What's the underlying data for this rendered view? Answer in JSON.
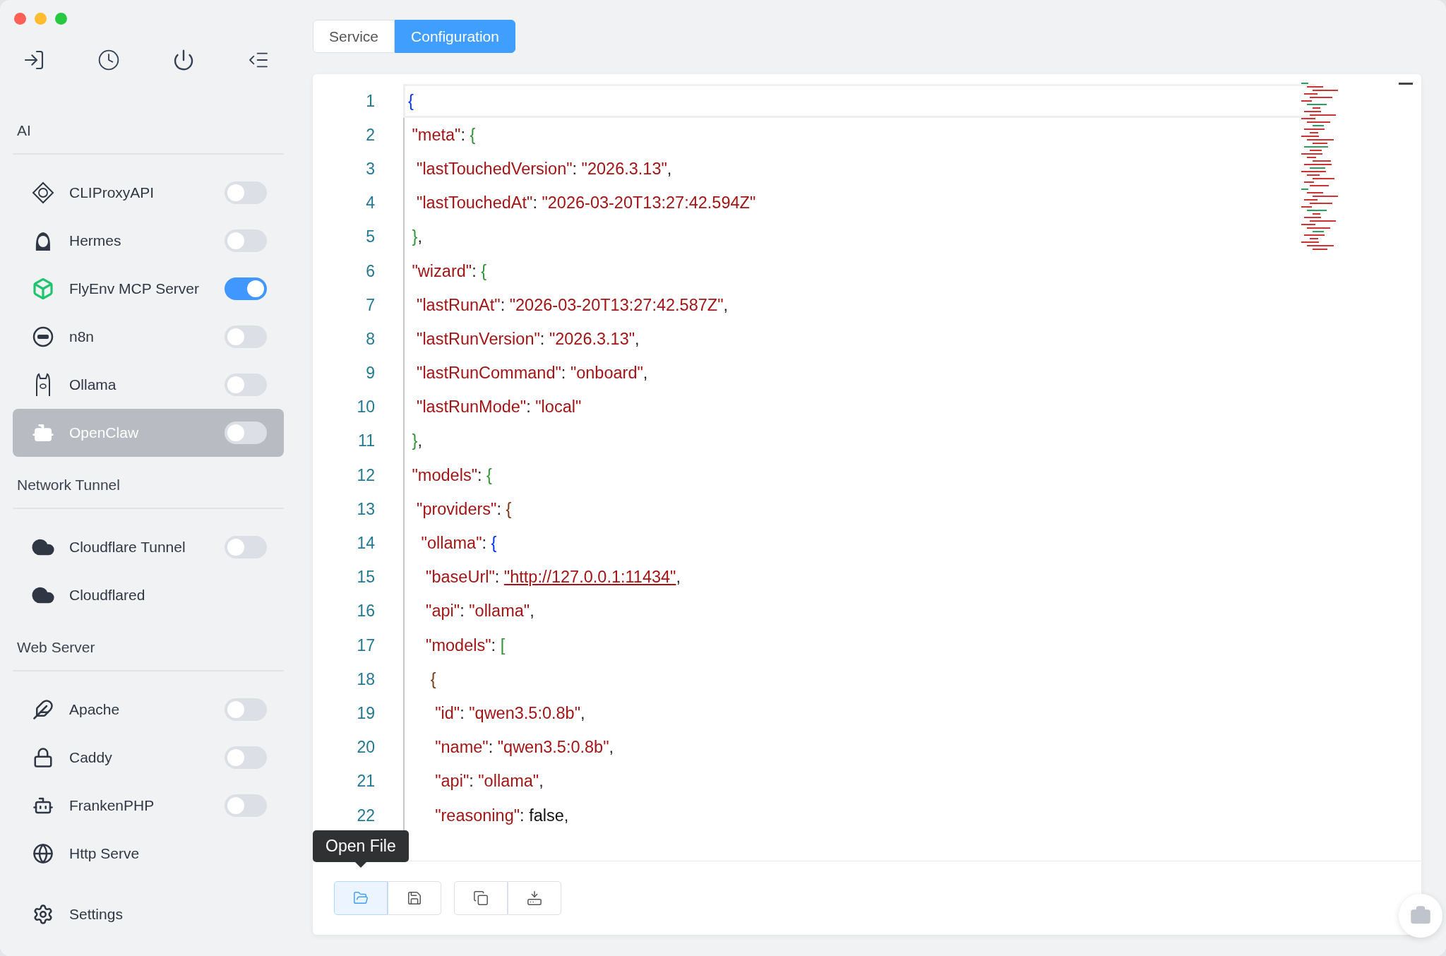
{
  "tabs": [
    {
      "label": "Service",
      "selected": false
    },
    {
      "label": "Configuration",
      "selected": true
    }
  ],
  "sidebar": {
    "groups": [
      {
        "title": "AI",
        "items": [
          {
            "label": "CLIProxyAPI",
            "on": false,
            "selected": false
          },
          {
            "label": "Hermes",
            "on": false,
            "selected": false
          },
          {
            "label": "FlyEnv MCP Server",
            "on": true,
            "selected": false
          },
          {
            "label": "n8n",
            "on": false,
            "selected": false
          },
          {
            "label": "Ollama",
            "on": false,
            "selected": false
          },
          {
            "label": "OpenClaw",
            "on": false,
            "selected": true
          }
        ]
      },
      {
        "title": "Network Tunnel",
        "items": [
          {
            "label": "Cloudflare Tunnel",
            "on": false,
            "selected": false
          },
          {
            "label": "Cloudflared",
            "selected": false
          }
        ]
      },
      {
        "title": "Web Server",
        "items": [
          {
            "label": "Apache",
            "on": false,
            "selected": false
          },
          {
            "label": "Caddy",
            "on": false,
            "selected": false
          },
          {
            "label": "FrankenPHP",
            "on": false,
            "selected": false
          },
          {
            "label": "Http Serve",
            "selected": false
          }
        ]
      }
    ],
    "settings": "Settings"
  },
  "editor": {
    "lines": [
      {
        "number": "1",
        "tokens": [
          {
            "kind": "bracket",
            "text": "{"
          }
        ]
      },
      {
        "number": "2",
        "tokens": [
          {
            "kind": "key",
            "text": " \"meta\""
          },
          {
            "kind": "punct",
            "text": ": "
          },
          {
            "kind": "bracket",
            "text": "{"
          }
        ]
      },
      {
        "number": "3",
        "tokens": [
          {
            "kind": "key",
            "text": "  \"lastTouchedVersion\""
          },
          {
            "kind": "punct",
            "text": ": "
          },
          {
            "kind": "string",
            "text": "\"2026.3.13\""
          },
          {
            "kind": "punct",
            "text": ","
          }
        ]
      },
      {
        "number": "4",
        "tokens": [
          {
            "kind": "key",
            "text": "  \"lastTouchedAt\""
          },
          {
            "kind": "punct",
            "text": ": "
          },
          {
            "kind": "string",
            "text": "\"2026-03-20T13:27:42.594Z\""
          }
        ]
      },
      {
        "number": "5",
        "tokens": [
          {
            "kind": "bracket",
            "text": " }"
          },
          {
            "kind": "punct",
            "text": ","
          }
        ]
      },
      {
        "number": "6",
        "tokens": [
          {
            "kind": "key",
            "text": " \"wizard\""
          },
          {
            "kind": "punct",
            "text": ": "
          },
          {
            "kind": "bracket",
            "text": "{"
          }
        ]
      },
      {
        "number": "7",
        "tokens": [
          {
            "kind": "key",
            "text": "  \"lastRunAt\""
          },
          {
            "kind": "punct",
            "text": ": "
          },
          {
            "kind": "string",
            "text": "\"2026-03-20T13:27:42.587Z\""
          },
          {
            "kind": "punct",
            "text": ","
          }
        ]
      },
      {
        "number": "8",
        "tokens": [
          {
            "kind": "key",
            "text": "  \"lastRunVersion\""
          },
          {
            "kind": "punct",
            "text": ": "
          },
          {
            "kind": "string",
            "text": "\"2026.3.13\""
          },
          {
            "kind": "punct",
            "text": ","
          }
        ]
      },
      {
        "number": "9",
        "tokens": [
          {
            "kind": "key",
            "text": "  \"lastRunCommand\""
          },
          {
            "kind": "punct",
            "text": ": "
          },
          {
            "kind": "string",
            "text": "\"onboard\""
          },
          {
            "kind": "punct",
            "text": ","
          }
        ]
      },
      {
        "number": "10",
        "tokens": [
          {
            "kind": "key",
            "text": "  \"lastRunMode\""
          },
          {
            "kind": "punct",
            "text": ": "
          },
          {
            "kind": "string",
            "text": "\"local\""
          }
        ]
      },
      {
        "number": "11",
        "tokens": [
          {
            "kind": "bracket",
            "text": " }"
          },
          {
            "kind": "punct",
            "text": ","
          }
        ]
      },
      {
        "number": "12",
        "tokens": [
          {
            "kind": "key",
            "text": " \"models\""
          },
          {
            "kind": "punct",
            "text": ": "
          },
          {
            "kind": "bracket",
            "text": "{"
          }
        ]
      },
      {
        "number": "13",
        "tokens": [
          {
            "kind": "key",
            "text": "  \"providers\""
          },
          {
            "kind": "punct",
            "text": ": "
          },
          {
            "kind": "bracket",
            "text": "{"
          }
        ]
      },
      {
        "number": "14",
        "tokens": [
          {
            "kind": "key",
            "text": "   \"ollama\""
          },
          {
            "kind": "punct",
            "text": ": "
          },
          {
            "kind": "bracket",
            "text": "{"
          }
        ]
      },
      {
        "number": "15",
        "tokens": [
          {
            "kind": "key",
            "text": "    \"baseUrl\""
          },
          {
            "kind": "punct",
            "text": ": "
          },
          {
            "kind": "link",
            "text": "\"http://127.0.0.1:11434\""
          },
          {
            "kind": "punct",
            "text": ","
          }
        ]
      },
      {
        "number": "16",
        "tokens": [
          {
            "kind": "key",
            "text": "    \"api\""
          },
          {
            "kind": "punct",
            "text": ": "
          },
          {
            "kind": "string",
            "text": "\"ollama\""
          },
          {
            "kind": "punct",
            "text": ","
          }
        ]
      },
      {
        "number": "17",
        "tokens": [
          {
            "kind": "key",
            "text": "    \"models\""
          },
          {
            "kind": "punct",
            "text": ": "
          },
          {
            "kind": "bracket",
            "text": "["
          }
        ]
      },
      {
        "number": "18",
        "tokens": [
          {
            "kind": "bracket",
            "text": "     {"
          }
        ]
      },
      {
        "number": "19",
        "tokens": [
          {
            "kind": "key",
            "text": "      \"id\""
          },
          {
            "kind": "punct",
            "text": ": "
          },
          {
            "kind": "string",
            "text": "\"qwen3.5:0.8b\""
          },
          {
            "kind": "punct",
            "text": ","
          }
        ]
      },
      {
        "number": "20",
        "tokens": [
          {
            "kind": "key",
            "text": "      \"name\""
          },
          {
            "kind": "punct",
            "text": ": "
          },
          {
            "kind": "string",
            "text": "\"qwen3.5:0.8b\""
          },
          {
            "kind": "punct",
            "text": ","
          }
        ]
      },
      {
        "number": "21",
        "tokens": [
          {
            "kind": "key",
            "text": "      \"api\""
          },
          {
            "kind": "punct",
            "text": ": "
          },
          {
            "kind": "string",
            "text": "\"ollama\""
          },
          {
            "kind": "punct",
            "text": ","
          }
        ]
      },
      {
        "number": "22",
        "tokens": [
          {
            "kind": "key",
            "text": "      \"reasoning\""
          },
          {
            "kind": "punct",
            "text": ": "
          },
          {
            "kind": "plain",
            "text": "false"
          },
          {
            "kind": "punct",
            "text": ","
          }
        ]
      }
    ]
  },
  "toolbar": {
    "buttons": [
      {
        "selected": true
      },
      {
        "selected": false
      },
      {
        "selected": false
      },
      {
        "selected": false
      }
    ],
    "tooltip": "Open File"
  }
}
